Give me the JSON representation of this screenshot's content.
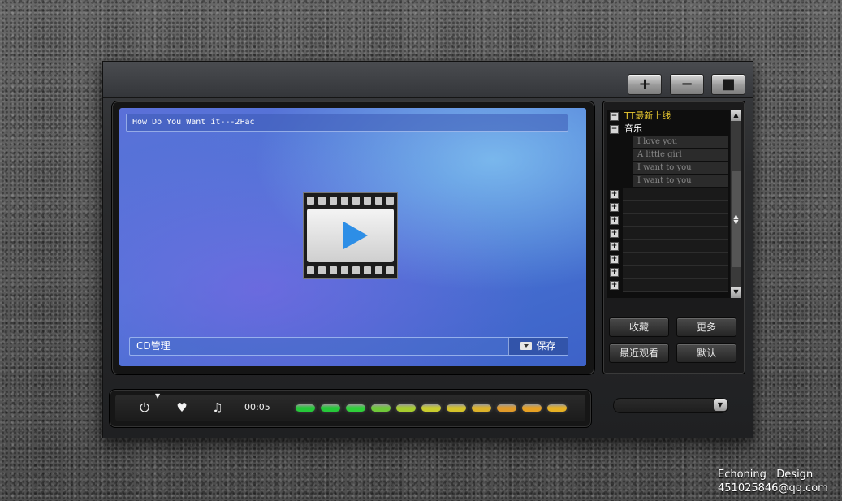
{
  "window_buttons": {
    "add": "+",
    "minimize": "−",
    "stop": "■"
  },
  "screen": {
    "track_title": "How Do You Want it---2Pac",
    "cd_label": "CD管理",
    "save_label": "保存"
  },
  "playlist": {
    "groups": [
      {
        "toggle": "−",
        "label": "TT最新上线",
        "color": "#e8c830"
      },
      {
        "toggle": "−",
        "label": "音乐",
        "color": "#ffffff"
      }
    ],
    "items": [
      "I love you",
      "A little girl",
      "I want to you",
      "I want to you"
    ],
    "collapsed_toggle": "+"
  },
  "actions": {
    "favorite": "收藏",
    "more": "更多",
    "recent": "最近观看",
    "default": "默认"
  },
  "controls": {
    "power_icon": "⏻",
    "heart_icon": "♥",
    "music_icon": "♫",
    "time": "00:05",
    "marker": "▼",
    "eq_colors": [
      "#26c83a",
      "#26c83a",
      "#2fcf3a",
      "#6fc83a",
      "#a6cc2e",
      "#c8cc2e",
      "#d4c22a",
      "#dcb22a",
      "#e09a2a",
      "#e6a024",
      "#e6b024"
    ]
  },
  "dropdown": {
    "arrow": "▼"
  },
  "credit": {
    "line1": "Echoning   Design",
    "line2": "451025846@qq.com"
  }
}
